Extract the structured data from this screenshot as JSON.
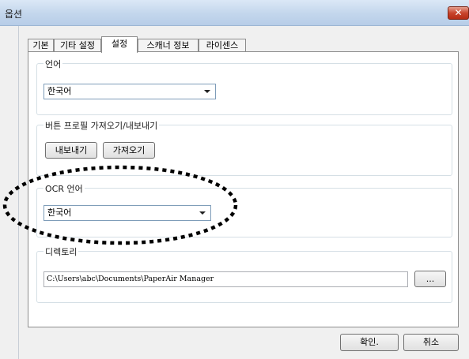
{
  "window": {
    "title": "옵션",
    "close_glyph": "✕"
  },
  "tabs": [
    {
      "label": "기본"
    },
    {
      "label": "기타 설정"
    },
    {
      "label": "설정",
      "active": true
    },
    {
      "label": "스캐너 정보"
    },
    {
      "label": "라이센스"
    }
  ],
  "language_group": {
    "legend": "언어",
    "selected": "한국어"
  },
  "profile_group": {
    "legend": "버튼 프로필 가져오기/내보내기",
    "export_label": "내보내기",
    "import_label": "가져오기"
  },
  "ocr_group": {
    "legend": "OCR 언어",
    "selected": "한국어"
  },
  "directory_group": {
    "legend": "디렉토리",
    "path": "C:\\Users\\abc\\Documents\\PaperAir Manager",
    "browse_label": "..."
  },
  "footer": {
    "ok_label": "확인.",
    "cancel_label": "취소"
  }
}
